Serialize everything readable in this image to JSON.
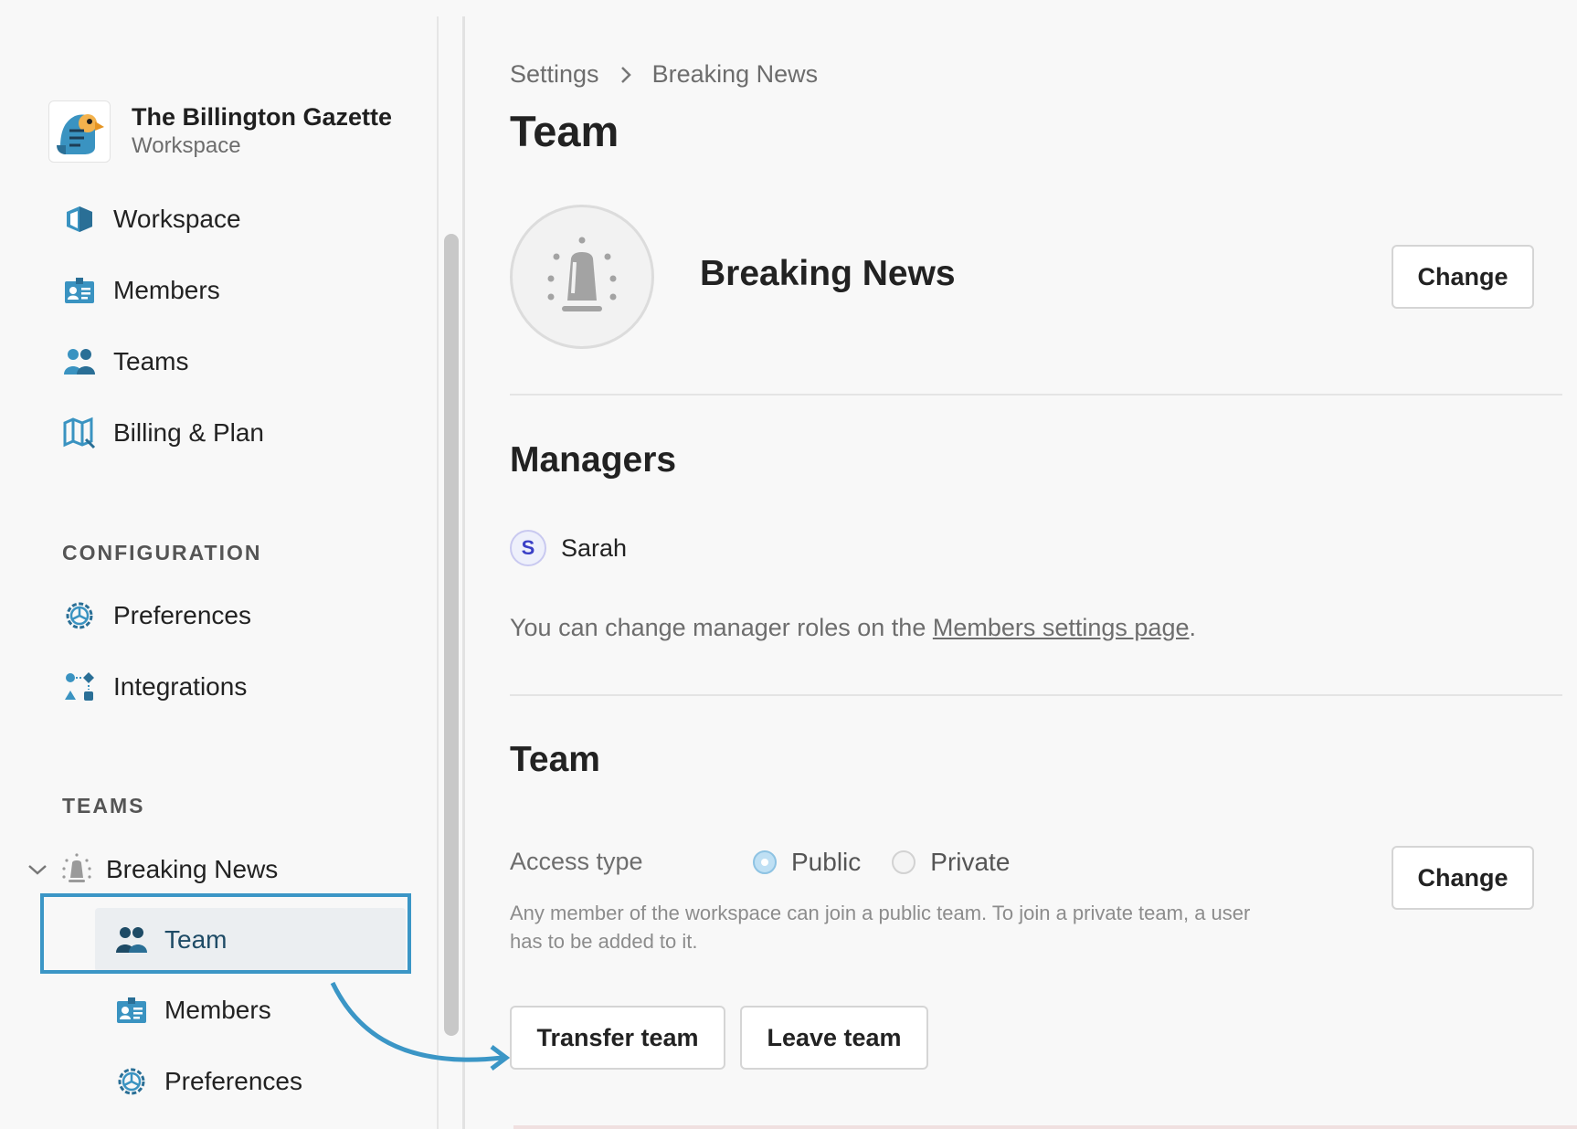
{
  "workspace": {
    "name": "The Billington Gazette",
    "subtitle": "Workspace"
  },
  "sidebar": {
    "main_items": [
      {
        "label": "Workspace",
        "icon": "workspace-icon"
      },
      {
        "label": "Members",
        "icon": "member-card-icon"
      },
      {
        "label": "Teams",
        "icon": "teams-icon"
      },
      {
        "label": "Billing & Plan",
        "icon": "billing-map-icon"
      }
    ],
    "configuration_label": "CONFIGURATION",
    "config_items": [
      {
        "label": "Preferences",
        "icon": "gear-icon"
      },
      {
        "label": "Integrations",
        "icon": "integrations-icon"
      }
    ],
    "teams_label": "TEAMS",
    "team_group": {
      "label": "Breaking News",
      "icon": "siren-icon",
      "expanded": true
    },
    "team_sub_items": [
      {
        "label": "Team",
        "icon": "teams-icon",
        "active": true
      },
      {
        "label": "Members",
        "icon": "member-card-icon"
      },
      {
        "label": "Preferences",
        "icon": "gear-icon"
      }
    ]
  },
  "main": {
    "breadcrumb": [
      "Settings",
      "Breaking News"
    ],
    "title": "Team",
    "team_name": "Breaking News",
    "change_avatar_label": "Change",
    "managers_heading": "Managers",
    "manager": {
      "initial": "S",
      "name": "Sarah"
    },
    "hint_prefix": "You can change manager roles on the ",
    "hint_link": "Members settings page",
    "hint_suffix": ".",
    "team_heading": "Team",
    "access_label": "Access type",
    "access_options": [
      "Public",
      "Private"
    ],
    "access_selected": "Public",
    "access_change_label": "Change",
    "access_desc": "Any member of the workspace can join a public team. To join a private team, a user has to be added to it.",
    "transfer_label": "Transfer team",
    "leave_label": "Leave team"
  },
  "colors": {
    "accent": "#3b96c6",
    "icon_blue": "#2c6e98",
    "radio_on": "#bfe0f4"
  }
}
